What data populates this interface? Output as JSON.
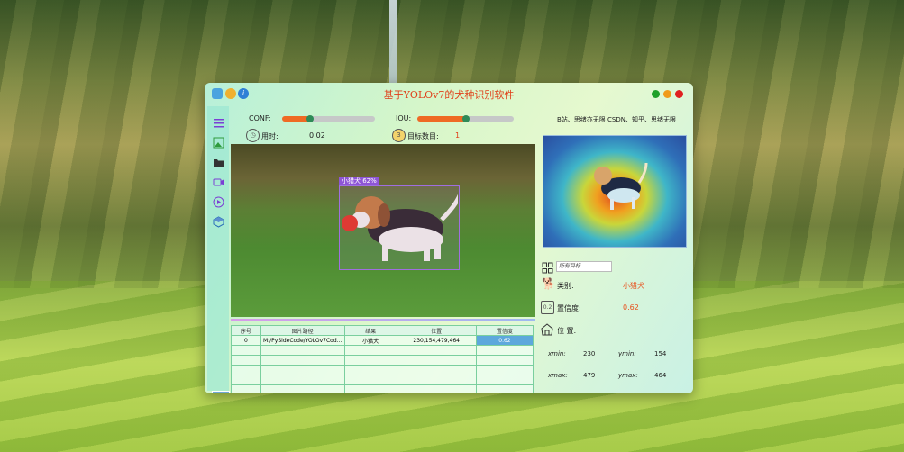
{
  "window": {
    "title": "基于YOLOv7的犬种识别软件"
  },
  "controls": {
    "conf_label": "CONF:",
    "conf_value": 0.3,
    "iou_label": "IOU:",
    "iou_value": 0.5,
    "time_label": "用时:",
    "time_value": "0.02",
    "count_label": "目标数目:",
    "count_value": "1"
  },
  "detection": {
    "box_label": "小猎犬 62%"
  },
  "table": {
    "headers": [
      "序号",
      "图片路径",
      "结果",
      "位置",
      "置信度"
    ],
    "rows": [
      [
        "0",
        "M:/PySideCode/YOLOv7Cod...",
        "小猎犬",
        "230,154,479,464",
        "0.62"
      ],
      [
        "",
        "",
        "",
        "",
        ""
      ],
      [
        "",
        "",
        "",
        "",
        ""
      ],
      [
        "",
        "",
        "",
        "",
        ""
      ],
      [
        "",
        "",
        "",
        "",
        ""
      ],
      [
        "",
        "",
        "",
        "",
        ""
      ],
      [
        "",
        "",
        "",
        "",
        ""
      ]
    ]
  },
  "right": {
    "credit": "B站、思绪亦无限 CSDN、知乎、思绪无限",
    "target_select": "所有目标",
    "class_label": "类别:",
    "class_value": "小猎犬",
    "conf_label": "置信度:",
    "conf_value": "0.62",
    "pos_label": "位 置:",
    "xmin_label": "xmin:",
    "xmin_value": "230",
    "ymin_label": "ymin:",
    "ymin_value": "154",
    "xmax_label": "xmax:",
    "xmax_value": "479",
    "ymax_label": "ymax:",
    "ymax_value": "464"
  },
  "colors": {
    "title": "#e0401a",
    "accent": "#ef6a24",
    "knob": "#2e8b57",
    "box": "#a06ee0",
    "highlight": "#5da8dc",
    "dot_green": "#1fa02a",
    "dot_orange": "#f09a1a",
    "dot_red": "#e02020"
  }
}
